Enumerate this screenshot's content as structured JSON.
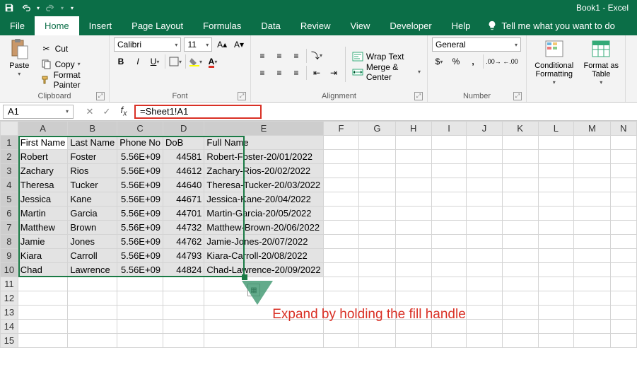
{
  "title": "Book1 - Excel",
  "tabs": [
    "File",
    "Home",
    "Insert",
    "Page Layout",
    "Formulas",
    "Data",
    "Review",
    "View",
    "Developer",
    "Help"
  ],
  "tellme": "Tell me what you want to do",
  "ribbon": {
    "paste": "Paste",
    "cut": "Cut",
    "copy": "Copy",
    "format_painter": "Format Painter",
    "clipboard": "Clipboard",
    "font_name": "Calibri",
    "font_size": "11",
    "font_group": "Font",
    "wrap": "Wrap Text",
    "merge": "Merge & Center",
    "alignment": "Alignment",
    "num_format": "General",
    "number": "Number",
    "cond": "Conditional Formatting",
    "fmt_table": "Format as Table"
  },
  "namebox": "A1",
  "formula": "=Sheet1!A1",
  "columns": [
    "A",
    "B",
    "C",
    "D",
    "E",
    "F",
    "G",
    "H",
    "I",
    "J",
    "K",
    "L",
    "M",
    "N"
  ],
  "headers": [
    "First Name",
    "Last Name",
    "Phone No",
    "DoB",
    "Full Name"
  ],
  "rows": [
    {
      "r": "1",
      "a": "First Name",
      "b": "Last Name",
      "c": "Phone No",
      "d": "DoB",
      "e": "Full Name"
    },
    {
      "r": "2",
      "a": "Robert",
      "b": "Foster",
      "c": "5.56E+09",
      "d": "44581",
      "e": "Robert-Foster-20/01/2022"
    },
    {
      "r": "3",
      "a": "Zachary",
      "b": "Rios",
      "c": "5.56E+09",
      "d": "44612",
      "e": "Zachary-Rios-20/02/2022"
    },
    {
      "r": "4",
      "a": "Theresa",
      "b": "Tucker",
      "c": "5.56E+09",
      "d": "44640",
      "e": "Theresa-Tucker-20/03/2022"
    },
    {
      "r": "5",
      "a": "Jessica",
      "b": "Kane",
      "c": "5.56E+09",
      "d": "44671",
      "e": "Jessica-Kane-20/04/2022"
    },
    {
      "r": "6",
      "a": "Martin",
      "b": "Garcia",
      "c": "5.56E+09",
      "d": "44701",
      "e": "Martin-Garcia-20/05/2022"
    },
    {
      "r": "7",
      "a": "Matthew",
      "b": "Brown",
      "c": "5.56E+09",
      "d": "44732",
      "e": "Matthew-Brown-20/06/2022"
    },
    {
      "r": "8",
      "a": "Jamie",
      "b": "Jones",
      "c": "5.56E+09",
      "d": "44762",
      "e": "Jamie-Jones-20/07/2022"
    },
    {
      "r": "9",
      "a": "Kiara",
      "b": "Carroll",
      "c": "5.56E+09",
      "d": "44793",
      "e": "Kiara-Carroll-20/08/2022"
    },
    {
      "r": "10",
      "a": "Chad",
      "b": "Lawrence",
      "c": "5.56E+09",
      "d": "44824",
      "e": "Chad-Lawrence-20/09/2022"
    }
  ],
  "annotation": "Expand by holding the fill handle"
}
